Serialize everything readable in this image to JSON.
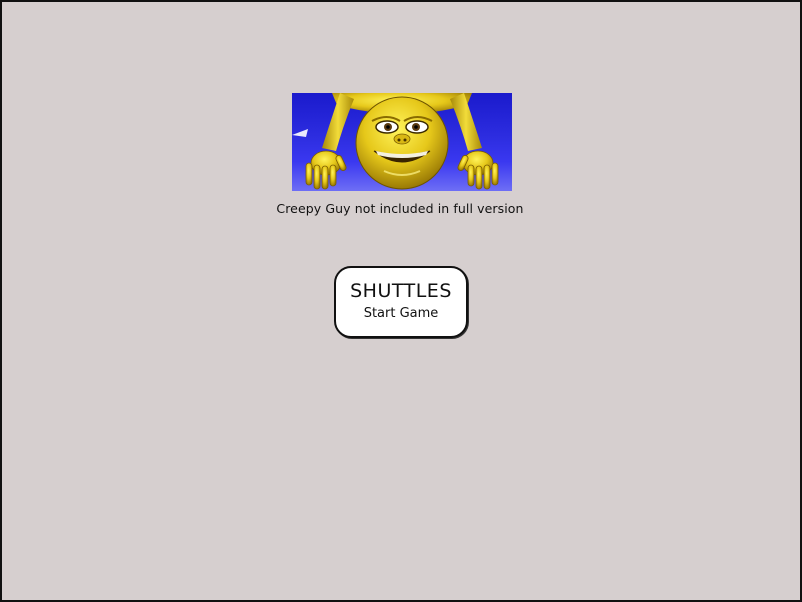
{
  "banner": {
    "image": "creepy-guy-face",
    "caption": "Creepy Guy not included in full version"
  },
  "start_button": {
    "title": "SHUTTLES",
    "subtitle": "Start Game"
  },
  "colors": {
    "background": "#d6cfcf",
    "banner_blue": "#2d2de0",
    "character_yellow": "#e8d020",
    "button_fill": "#ffffff",
    "border": "#111111"
  }
}
